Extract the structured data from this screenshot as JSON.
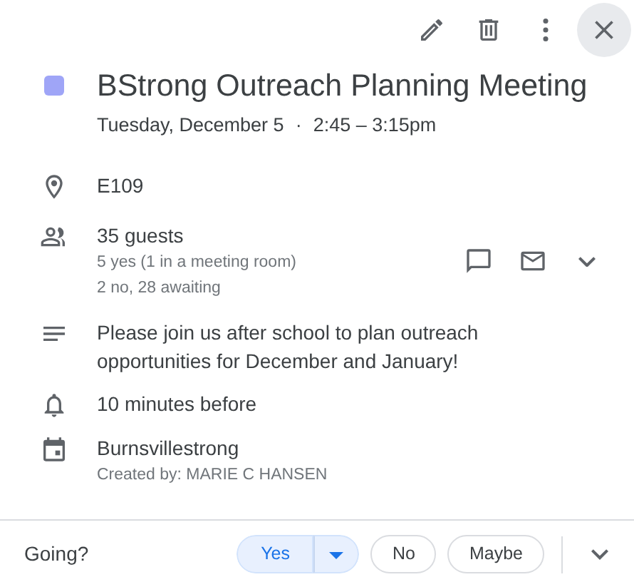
{
  "event": {
    "color": "#9fa5f7",
    "title": "BStrong Outreach Planning Meeting",
    "date": "Tuesday, December 5",
    "separator": "·",
    "time": "2:45 – 3:15pm"
  },
  "details": [
    {
      "kind": "location",
      "text": "E109"
    },
    {
      "kind": "guests",
      "text": "35 guests",
      "subtexts": [
        "5 yes (1 in a meeting room)",
        "2 no, 28 awaiting"
      ]
    },
    {
      "kind": "description",
      "text": "Please join us after school to plan outreach opportunities for December and January!"
    },
    {
      "kind": "reminder",
      "text": "10 minutes before"
    },
    {
      "kind": "calendar",
      "text": "Burnsvillestrong",
      "subtexts": [
        "Created by: MARIE C HANSEN"
      ]
    }
  ],
  "footer": {
    "prompt": "Going?",
    "options": [
      {
        "label": "Yes",
        "selected": true
      },
      {
        "label": "No",
        "selected": false
      },
      {
        "label": "Maybe",
        "selected": false
      }
    ]
  }
}
